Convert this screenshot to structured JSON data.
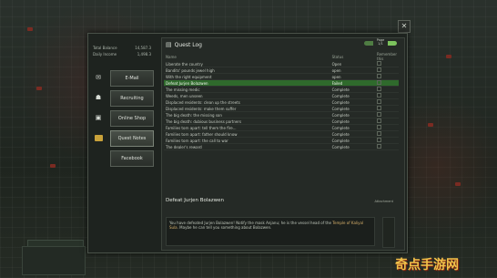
{
  "stats": [
    {
      "label": "Total Balance",
      "value": "14,587.3"
    },
    {
      "label": "Daily Income",
      "value": "1,498.3"
    }
  ],
  "menu": [
    {
      "label": "E-Mail",
      "icon": "envelope-icon"
    },
    {
      "label": "Recruiting",
      "icon": "recruit-icon"
    },
    {
      "label": "Online Shop",
      "icon": "shop-icon"
    },
    {
      "label": "Quest Notes",
      "icon": "folder-icon",
      "active": true
    },
    {
      "label": "Facebook",
      "icon": "facebook-icon"
    }
  ],
  "quest_log": {
    "title": "Quest Log",
    "page_label": "Page",
    "page_value": "1/1",
    "headers": {
      "name": "Name",
      "status": "Status",
      "remember": "Remember this"
    },
    "rows": [
      {
        "name": "Liberate the country",
        "status": "Open"
      },
      {
        "name": "Bandits' pounds jewel high",
        "status": "open"
      },
      {
        "name": "With the right equipment",
        "status": "open"
      },
      {
        "name": "Defeat Jurjen Bolazwen",
        "status": "Failed"
      },
      {
        "name": "The missing medic",
        "status": "Complete"
      },
      {
        "name": "Weeds, men unseen",
        "status": "Complete"
      },
      {
        "name": "Displaced residents: clean up the streets",
        "status": "Complete"
      },
      {
        "name": "Displaced residents: make them suffer",
        "status": "Complete"
      },
      {
        "name": "The big death: the missing son",
        "status": "Complete"
      },
      {
        "name": "The big death: dubious business partners",
        "status": "Complete"
      },
      {
        "name": "Families torn apart: tell them the fire...",
        "status": "Complete"
      },
      {
        "name": "Families torn apart: father should know",
        "status": "Complete"
      },
      {
        "name": "Families torn apart: the call to war",
        "status": "Complete"
      },
      {
        "name": "The dealer's reward",
        "status": "Complete"
      }
    ],
    "selected_index": 3
  },
  "detail": {
    "title": "Defeat Jurjen Bolazwen",
    "attachment_label": "Attachment",
    "body_text": "You have defeated Jurjen Bolazwen! Notify the mask Anjanu; he is the vessel head of the",
    "body_highlight": "Temple of Kaliyal Sula",
    "body_tail": ". Maybe he can tell you something about Bolazwen."
  },
  "watermark": "奇点手游网"
}
